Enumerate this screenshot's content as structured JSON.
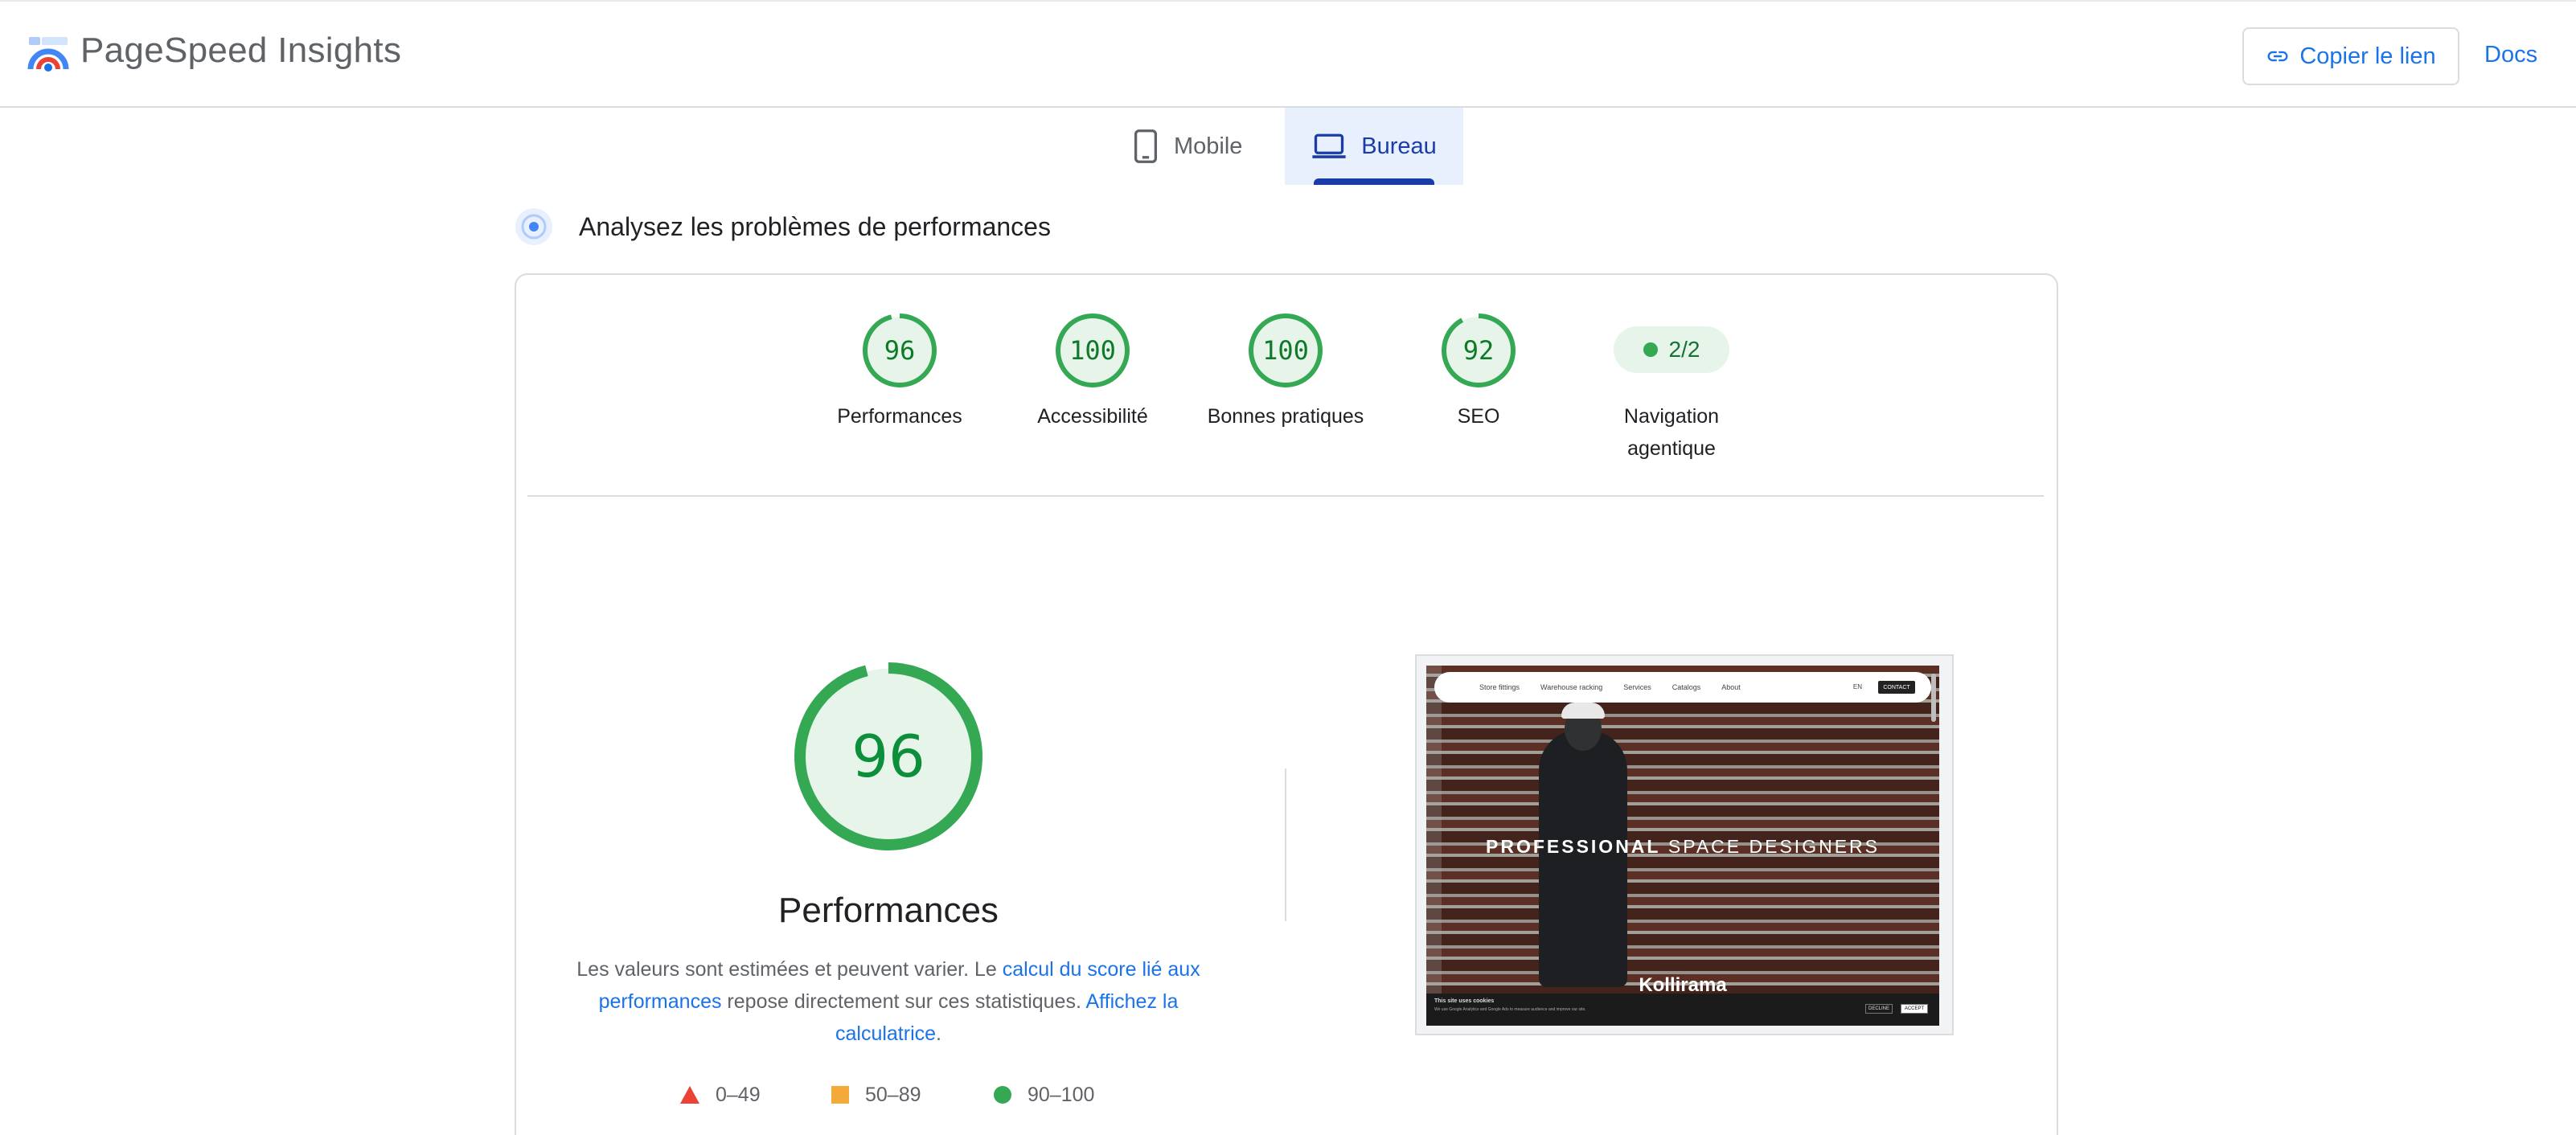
{
  "header": {
    "brand": "PageSpeed Insights",
    "copy_link": "Copier le lien",
    "docs": "Docs"
  },
  "tabs": [
    {
      "label": "Mobile",
      "icon": "phone-icon",
      "selected": false
    },
    {
      "label": "Bureau",
      "icon": "laptop-icon",
      "selected": true
    }
  ],
  "section": {
    "title": "Analysez les problèmes de performances"
  },
  "scores": [
    {
      "value": 96,
      "label": "Performances"
    },
    {
      "value": 100,
      "label": "Accessibilité"
    },
    {
      "value": 100,
      "label": "Bonnes pratiques"
    },
    {
      "value": 92,
      "label": "SEO"
    }
  ],
  "agentic": {
    "value": "2/2",
    "label": "Navigation agentique"
  },
  "performance": {
    "score": 96,
    "title": "Performances",
    "desc_prefix": "Les valeurs sont estimées et peuvent varier. Le ",
    "link_score": "calcul du score lié aux performances",
    "desc_middle": " repose directement sur ces statistiques. ",
    "link_calc": "Affichez la calculatrice",
    "desc_suffix": "."
  },
  "legend": [
    {
      "range": "0–49",
      "shape": "triangle",
      "color": "#eb4335"
    },
    {
      "range": "50–89",
      "shape": "square",
      "color": "#f4a93b"
    },
    {
      "range": "90–100",
      "shape": "circle",
      "color": "#34a853"
    }
  ],
  "screenshot": {
    "nav": [
      "Store fittings",
      "Warehouse racking",
      "Services",
      "Catalogs",
      "About"
    ],
    "lang": "EN",
    "contact": "CONTACT",
    "hero_bold": "PROFESSIONAL",
    "hero_rest": " SPACE DESIGNERS",
    "brand": "Kollirama",
    "cookie_title": "This site uses cookies",
    "cookie_text": "We use Google Analytics and Google Ads to measure audience and improve our site.",
    "decline": "DECLINE",
    "accept": "ACCEPT"
  },
  "colors": {
    "good": "#34a853",
    "good_fill": "#e6f4ea",
    "good_text": "#0d7a27",
    "link": "#1a73e8",
    "tab_active": "#1a3ca8"
  }
}
